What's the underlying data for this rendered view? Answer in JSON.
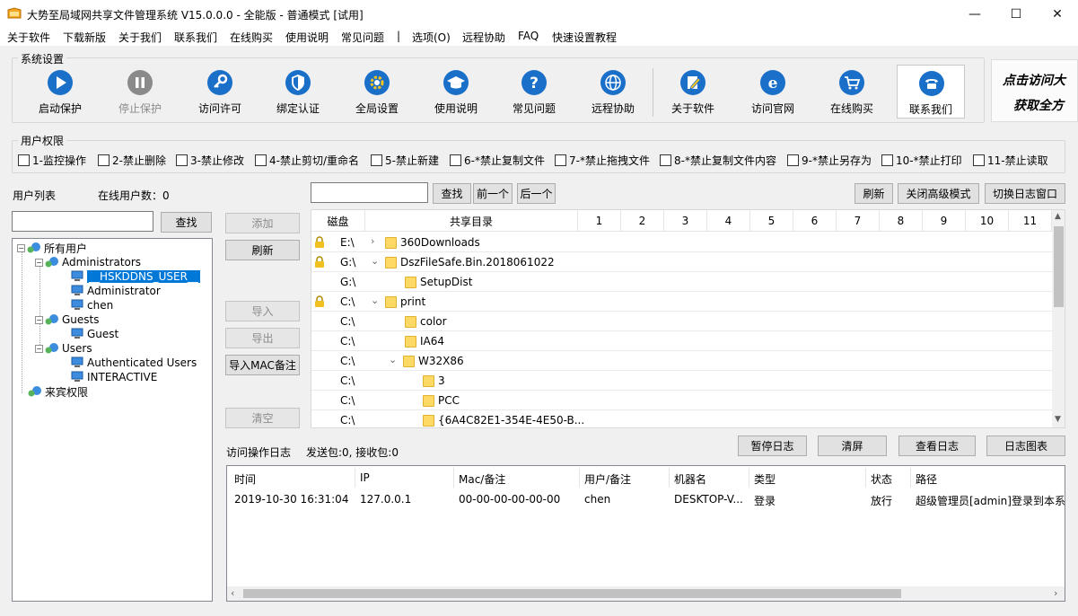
{
  "window": {
    "title": "大势至局域网共享文件管理系统 V15.0.0.0 - 全能版 - 普通模式 [试用]",
    "minimize": "—",
    "maximize": "☐",
    "close": "✕"
  },
  "menu": [
    "关于软件",
    "下载新版",
    "关于我们",
    "联系我们",
    "在线购买",
    "使用说明",
    "常见问题",
    "|",
    "选项(O)",
    "远程协助",
    "FAQ",
    "快速设置教程"
  ],
  "system_settings": {
    "title": "系统设置",
    "buttons": [
      {
        "label": "启动保护",
        "icon": "play-icon",
        "enabled": true
      },
      {
        "label": "停止保护",
        "icon": "pause-icon",
        "enabled": false
      },
      {
        "label": "访问许可",
        "icon": "key-icon",
        "enabled": true
      },
      {
        "label": "绑定认证",
        "icon": "shield-icon",
        "enabled": true
      },
      {
        "label": "全局设置",
        "icon": "gear-icon",
        "enabled": true
      },
      {
        "label": "使用说明",
        "icon": "graduation-cap-icon",
        "enabled": true
      },
      {
        "label": "常见问题",
        "icon": "question-icon",
        "enabled": true
      },
      {
        "label": "远程协助",
        "icon": "globe-icon",
        "enabled": true
      },
      {
        "label": "关于软件",
        "icon": "document-edit-icon",
        "enabled": true
      },
      {
        "label": "访问官网",
        "icon": "browser-e-icon",
        "enabled": true
      },
      {
        "label": "在线购买",
        "icon": "cart-icon",
        "enabled": true
      },
      {
        "label": "联系我们",
        "icon": "phone-icon",
        "enabled": true
      }
    ],
    "banner_line1": "点击访问大",
    "banner_line2": "获取全方"
  },
  "user_permissions": {
    "title": "用户权限",
    "options": [
      "1-监控操作",
      "2-禁止删除",
      "3-禁止修改",
      "4-禁止剪切/重命名",
      "5-禁止新建",
      "6-*禁止复制文件",
      "7-*禁止拖拽文件",
      "8-*禁止复制文件内容",
      "9-*禁止另存为",
      "10-*禁止打印",
      "11-禁止读取"
    ]
  },
  "user_list": {
    "label": "用户列表",
    "online_label": "在线用户数：0",
    "search_value": "",
    "search_button": "查找",
    "tree": {
      "root": "所有用户",
      "administrators": "Administrators",
      "hsk_user": "__HSKDDNS_USER__",
      "administrator": "Administrator",
      "chen": "chen",
      "guests": "Guests",
      "guest": "Guest",
      "users": "Users",
      "authenticated_users": "Authenticated Users",
      "interactive": "INTERACTIVE",
      "guest_permission": "来宾权限"
    }
  },
  "middle_buttons": {
    "add": "添加",
    "refresh": "刷新",
    "import": "导入",
    "export": "导出",
    "import_mac": "导入MAC备注",
    "clear": "清空"
  },
  "share_toolbar": {
    "search_value": "",
    "search": "查找",
    "prev": "前一个",
    "next": "后一个",
    "refresh": "刷新",
    "close_advanced": "关闭高级模式",
    "toggle_log": "切换日志窗口"
  },
  "share_grid": {
    "headers": [
      "磁盘",
      "共享目录",
      "1",
      "2",
      "3",
      "4",
      "5",
      "6",
      "7",
      "8",
      "9",
      "10",
      "11"
    ],
    "rows": [
      {
        "drive": "E:\\",
        "name": "360Downloads",
        "locked": true,
        "expander": "›"
      },
      {
        "drive": "G:\\",
        "name": "DszFileSafe.Bin.2018061022",
        "locked": true,
        "expander": "⌄"
      },
      {
        "drive": "G:\\",
        "name": "SetupDist",
        "locked": false,
        "expander": ""
      },
      {
        "drive": "C:\\",
        "name": "print",
        "locked": true,
        "expander": "⌄"
      },
      {
        "drive": "C:\\",
        "name": "color",
        "locked": false,
        "expander": ""
      },
      {
        "drive": "C:\\",
        "name": "IA64",
        "locked": false,
        "expander": ""
      },
      {
        "drive": "C:\\",
        "name": "W32X86",
        "locked": false,
        "expander": "⌄"
      },
      {
        "drive": "C:\\",
        "name": "3",
        "locked": false,
        "expander": ""
      },
      {
        "drive": "C:\\",
        "name": "PCC",
        "locked": false,
        "expander": ""
      },
      {
        "drive": "C:\\",
        "name": "{6A4C82E1-354E-4E50-B...",
        "locked": false,
        "expander": ""
      }
    ]
  },
  "log": {
    "label": "访问操作日志",
    "packets": "发送包:0, 接收包:0",
    "pause": "暂停日志",
    "clear": "清屏",
    "view": "查看日志",
    "chart": "日志图表",
    "headers": [
      "时间",
      "IP",
      "Mac/备注",
      "用户/备注",
      "机器名",
      "类型",
      "状态",
      "路径"
    ],
    "rows": [
      [
        "2019-10-30 16:31:04",
        "127.0.0.1",
        "00-00-00-00-00-00",
        "chen",
        "DESKTOP-V...",
        "登录",
        "放行",
        "超级管理员[admin]登录到本系统"
      ]
    ]
  },
  "colors": {
    "accent": "#1a6fc9",
    "selection": "#0078d7",
    "folder": "#ffd966"
  }
}
